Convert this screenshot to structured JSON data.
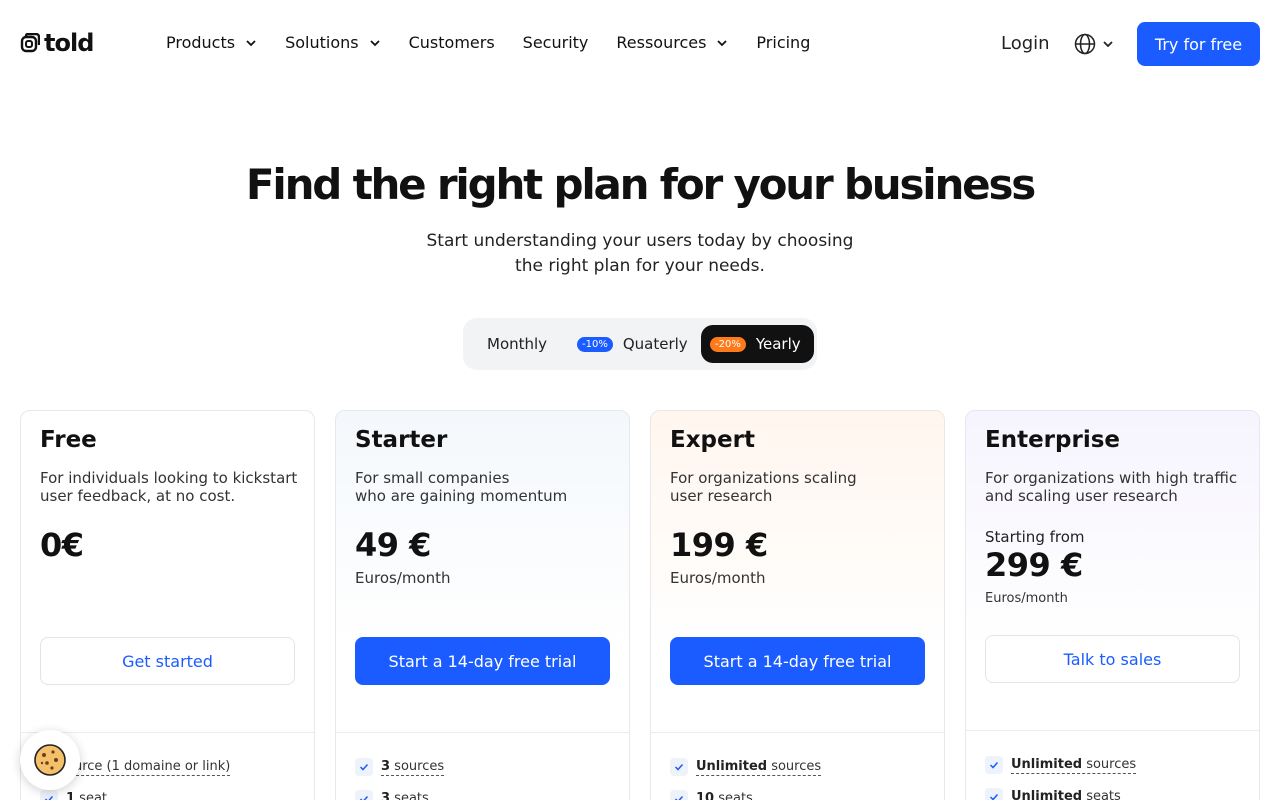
{
  "brand": {
    "name": "told",
    "accent": "#1a5cff",
    "badge_orange": "#ff7a1a"
  },
  "nav": {
    "items": [
      {
        "label": "Products",
        "dropdown": true
      },
      {
        "label": "Solutions",
        "dropdown": true
      },
      {
        "label": "Customers",
        "dropdown": false
      },
      {
        "label": "Security",
        "dropdown": false
      },
      {
        "label": "Ressources",
        "dropdown": true
      },
      {
        "label": "Pricing",
        "dropdown": false
      }
    ],
    "login": "Login",
    "language_icon": "globe-icon",
    "cta": "Try for free"
  },
  "hero": {
    "title": "Find the right plan for your business",
    "subtitle_line1": "Start understanding your users today by choosing",
    "subtitle_line2": "the right plan for your needs."
  },
  "billing": {
    "monthly": "Monthly",
    "quarterly_badge": "-10%",
    "quarterly": "Quaterly",
    "yearly_badge": "-20%",
    "yearly": "Yearly",
    "selected": "Yearly"
  },
  "plans": [
    {
      "name": "Free",
      "desc1": "For individuals looking to kickstart",
      "desc2": "user feedback, at no cost.",
      "price": "0€",
      "period": "",
      "cta": "Get started",
      "features": [
        {
          "bold": "",
          "text": "ource (1 domaine or link)"
        },
        {
          "bold": "1",
          "text": " seat"
        }
      ]
    },
    {
      "name": "Starter",
      "desc1": "For small companies",
      "desc2": "who are gaining momentum",
      "price": "49 €",
      "period": "Euros/month",
      "cta": "Start a 14-day free trial",
      "features": [
        {
          "bold": "3",
          "text": " sources"
        },
        {
          "bold": "3",
          "text": " seats"
        }
      ]
    },
    {
      "name": "Expert",
      "desc1": "For organizations scaling",
      "desc2": "user research",
      "price": "199 €",
      "period": "Euros/month",
      "cta": "Start a 14-day free trial",
      "features": [
        {
          "bold": "Unlimited",
          "text": " sources"
        },
        {
          "bold": "10",
          "text": " seats"
        }
      ]
    },
    {
      "name": "Enterprise",
      "desc1": "For organizations with high traffic",
      "desc2": "and scaling user research",
      "from": "Starting from",
      "price": "299 €",
      "period": "Euros/month",
      "cta": "Talk to sales",
      "features": [
        {
          "bold": "Unlimited",
          "text": " sources"
        },
        {
          "bold": "Unlimited",
          "text": " seats"
        }
      ]
    }
  ],
  "cookie_icon": "cookie-icon"
}
